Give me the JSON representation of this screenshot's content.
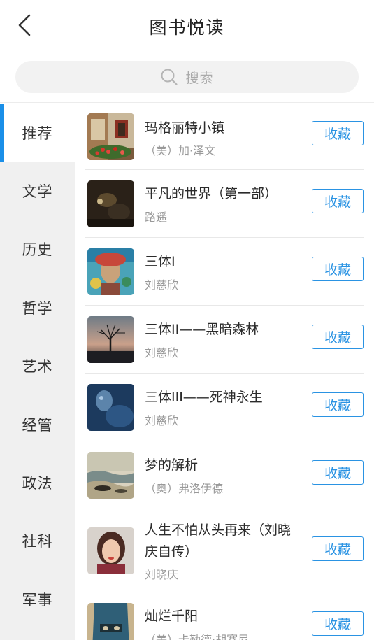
{
  "header": {
    "title": "图书悦读",
    "back_icon": "chevron-left-icon"
  },
  "search": {
    "placeholder": "搜索",
    "icon": "search-icon"
  },
  "sidebar": {
    "items": [
      {
        "label": "推荐",
        "active": true
      },
      {
        "label": "文学",
        "active": false
      },
      {
        "label": "历史",
        "active": false
      },
      {
        "label": "哲学",
        "active": false
      },
      {
        "label": "艺术",
        "active": false
      },
      {
        "label": "经管",
        "active": false
      },
      {
        "label": "政法",
        "active": false
      },
      {
        "label": "社科",
        "active": false
      },
      {
        "label": "军事",
        "active": false
      }
    ],
    "active_color": "#1a8fe8"
  },
  "books": [
    {
      "title": "玛格丽特小镇",
      "author": "（美）加·泽文",
      "action": "收藏"
    },
    {
      "title": "平凡的世界（第一部）",
      "author": "路遥",
      "action": "收藏"
    },
    {
      "title": "三体I",
      "author": "刘慈欣",
      "action": "收藏"
    },
    {
      "title": "三体II——黑暗森林",
      "author": "刘慈欣",
      "action": "收藏"
    },
    {
      "title": "三体III——死神永生",
      "author": "刘慈欣",
      "action": "收藏"
    },
    {
      "title": "梦的解析",
      "author": "（奥）弗洛伊德",
      "action": "收藏"
    },
    {
      "title": "人生不怕从头再来（刘晓庆自传）",
      "author": "刘晓庆",
      "action": "收藏"
    },
    {
      "title": "灿烂千阳",
      "author": "（美）卡勒德·胡赛尼",
      "action": "收藏"
    }
  ],
  "colors": {
    "accent": "#2a93e3",
    "sidebar_bg": "#f0f0f0"
  }
}
